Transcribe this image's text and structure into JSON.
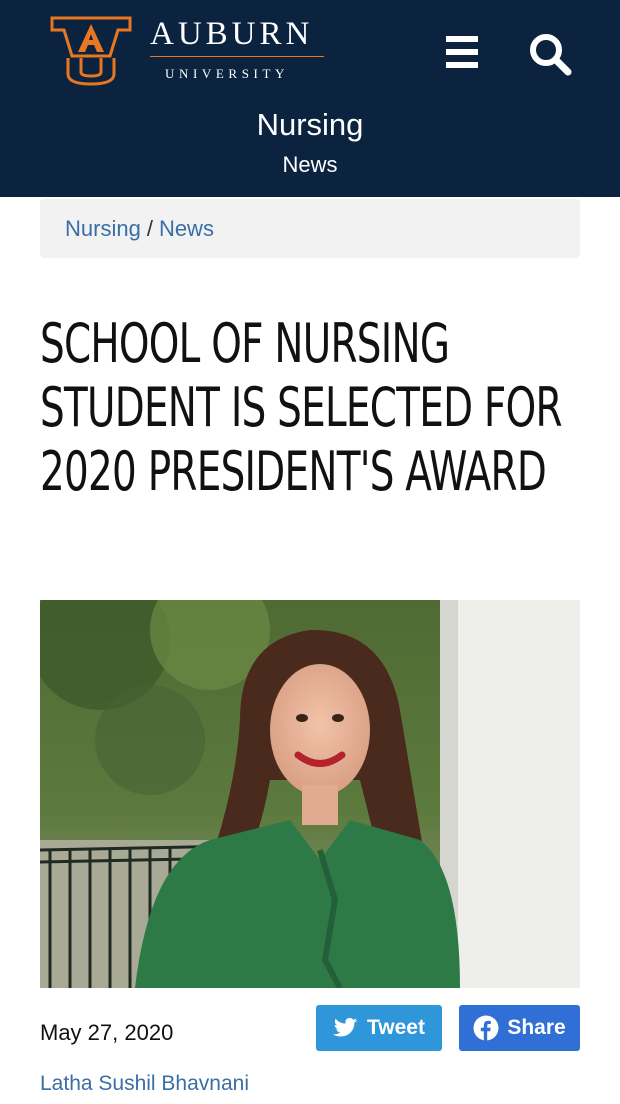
{
  "header": {
    "logo_icon": "au-monogram-icon",
    "wordmark_top": "AUBURN",
    "wordmark_bottom": "UNIVERSITY",
    "menu_icon": "hamburger-menu-icon",
    "search_icon": "search-icon",
    "site_title": "Nursing",
    "site_subtitle": "News",
    "colors": {
      "navy": "#0c2340",
      "orange": "#e87722"
    }
  },
  "breadcrumb": {
    "items": [
      {
        "label": "Nursing"
      },
      {
        "label": "News"
      }
    ],
    "separator": "/"
  },
  "article": {
    "title": "SCHOOL OF NURSING STUDENT IS SELECTED FOR 2020 PRESIDENT'S AWARD",
    "photo_icon": "portrait-photo",
    "date": "May 27, 2020",
    "author": "Latha Sushil Bhavnani"
  },
  "share": {
    "tweet_label": "Tweet",
    "tweet_icon": "twitter-bird-icon",
    "share_label": "Share",
    "share_icon": "facebook-icon",
    "colors": {
      "twitter": "#2f97d9",
      "facebook": "#2f6fd6",
      "link": "#3a6ea5"
    }
  }
}
